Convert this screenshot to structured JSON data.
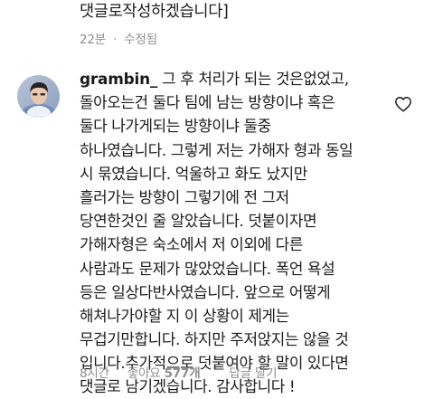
{
  "previous_comment": {
    "text_tail": "댓글로작성하겠습니다]",
    "time": "22분",
    "separator": "·",
    "edited_label": "수정됨"
  },
  "comment": {
    "username": "grambin_",
    "lines": [
      " 그 후 처리가 되는 것은없었고,",
      "돌아오는건 둘다 팀에 남는 방향이냐 혹은",
      "둘다 나가게되는 방향이냐 둘중",
      "하나였습니다. 그렇게 저는 가해자 형과 동일",
      "시 묶였습니다. 억울하고 화도 났지만",
      "흘러가는 방향이 그렇기에 전 그저",
      "당연한것인 줄 알았습니다. 덧붙이자면",
      "가해자형은 숙소에서 저 이외에 다른",
      "사람과도 문제가 많았었습니다. 폭언 욕설",
      "등은 일상다반사였습니다. 앞으로 어떻게",
      "해쳐나가야할 지 이 상황이 제게는",
      "무겁기만합니다. 하지만 주저앉지는 않을 것",
      "입니다.추가적으로 덧붙여야 할 말이 있다면",
      "댓글로 남기겠습니다. 감사합니다 !"
    ],
    "time": "8시간",
    "likes_label": "좋아요",
    "likes_count": "577개",
    "reply_label": "답글 달기",
    "like_icon": "heart-outline-icon",
    "accent_color": "#262626",
    "meta_color": "#8e8e8e"
  }
}
